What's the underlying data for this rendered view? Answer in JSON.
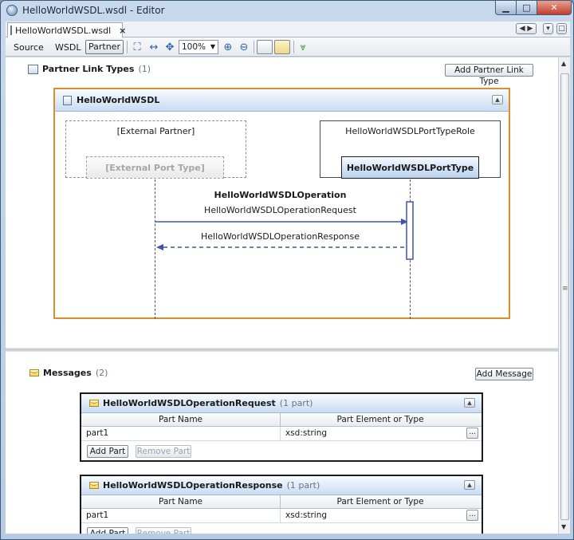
{
  "window": {
    "title": "HelloWorldWSDL.wsdl - Editor"
  },
  "tab": {
    "label": "HelloWorldWSDL.wsdl",
    "close": "×"
  },
  "toolbar": {
    "source": "Source",
    "wsdl": "WSDL",
    "partner": "Partner",
    "zoom": "100%"
  },
  "partner_link_types": {
    "title": "Partner Link Types",
    "count": "(1)",
    "add_button": "Add Partner Link Type",
    "link": {
      "name": "HelloWorldWSDL",
      "external_partner": "[External Partner]",
      "external_port_type": "[External Port Type]",
      "role": "HelloWorldWSDLPortTypeRole",
      "port_type": "HelloWorldWSDLPortType",
      "operation": "HelloWorldWSDLOperation",
      "request": "HelloWorldWSDLOperationRequest",
      "response": "HelloWorldWSDLOperationResponse"
    }
  },
  "messages": {
    "title": "Messages",
    "count": "(2)",
    "add_button": "Add Message",
    "items": [
      {
        "name": "HelloWorldWSDLOperationRequest",
        "parts_count": "(1 part)",
        "col_name": "Part Name",
        "col_type": "Part Element or Type",
        "part_name": "part1",
        "part_type": "xsd:string",
        "add_part": "Add Part",
        "remove_part": "Remove Part"
      },
      {
        "name": "HelloWorldWSDLOperationResponse",
        "parts_count": "(1 part)",
        "col_name": "Part Name",
        "col_type": "Part Element or Type",
        "part_name": "part1",
        "part_type": "xsd:string",
        "add_part": "Add Part",
        "remove_part": "Remove Part"
      }
    ],
    "ellipsis": "..."
  },
  "colors": {
    "accent_orange": "#e08b2c",
    "arrow_blue": "#3b56a8",
    "header_blue": "#c9dcf2"
  }
}
